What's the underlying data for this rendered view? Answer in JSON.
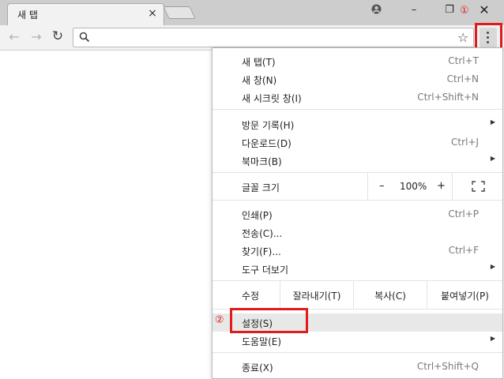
{
  "tab": {
    "title": "새 탭",
    "close": "×"
  },
  "window": {
    "profile": "●",
    "minimize": "–",
    "restore": "❐",
    "close": "✕"
  },
  "markers": {
    "one": "①",
    "two": "②"
  },
  "toolbar": {
    "back": "←",
    "forward": "→",
    "reload": "↻",
    "star": "☆",
    "omnibox_value": ""
  },
  "menu": {
    "group1": [
      {
        "label": "새 탭(T)",
        "shortcut": "Ctrl+T"
      },
      {
        "label": "새 창(N)",
        "shortcut": "Ctrl+N"
      },
      {
        "label": "새 시크릿 창(I)",
        "shortcut": "Ctrl+Shift+N"
      }
    ],
    "group2": [
      {
        "label": "방문 기록(H)",
        "shortcut": "",
        "submenu": "▶"
      },
      {
        "label": "다운로드(D)",
        "shortcut": "Ctrl+J"
      },
      {
        "label": "북마크(B)",
        "shortcut": "",
        "submenu": "▶"
      }
    ],
    "zoom": {
      "label": "글꼴 크기",
      "minus": "–",
      "value": "100%",
      "plus": "+"
    },
    "group3": [
      {
        "label": "인쇄(P)",
        "shortcut": "Ctrl+P"
      },
      {
        "label": "전송(C)...",
        "shortcut": ""
      },
      {
        "label": "찾기(F)...",
        "shortcut": "Ctrl+F"
      },
      {
        "label": "도구 더보기",
        "shortcut": "",
        "submenu": "▶"
      }
    ],
    "edit": {
      "label": "수정",
      "cut": "잘라내기(T)",
      "copy": "복사(C)",
      "paste": "붙여넣기(P)"
    },
    "group4": [
      {
        "label": "설정(S)",
        "shortcut": ""
      },
      {
        "label": "도움말(E)",
        "shortcut": "",
        "submenu": "▶"
      }
    ],
    "group5": [
      {
        "label": "종료(X)",
        "shortcut": "Ctrl+Shift+Q"
      }
    ]
  }
}
